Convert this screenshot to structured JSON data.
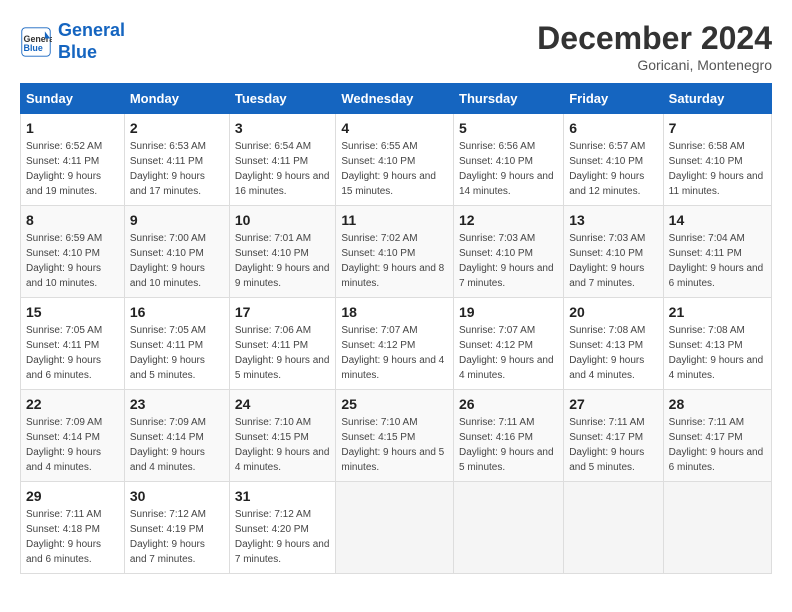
{
  "header": {
    "logo_line1": "General",
    "logo_line2": "Blue",
    "month": "December 2024",
    "location": "Goricani, Montenegro"
  },
  "columns": [
    "Sunday",
    "Monday",
    "Tuesday",
    "Wednesday",
    "Thursday",
    "Friday",
    "Saturday"
  ],
  "weeks": [
    [
      {
        "day": "1",
        "sunrise": "Sunrise: 6:52 AM",
        "sunset": "Sunset: 4:11 PM",
        "daylight": "Daylight: 9 hours and 19 minutes."
      },
      {
        "day": "2",
        "sunrise": "Sunrise: 6:53 AM",
        "sunset": "Sunset: 4:11 PM",
        "daylight": "Daylight: 9 hours and 17 minutes."
      },
      {
        "day": "3",
        "sunrise": "Sunrise: 6:54 AM",
        "sunset": "Sunset: 4:11 PM",
        "daylight": "Daylight: 9 hours and 16 minutes."
      },
      {
        "day": "4",
        "sunrise": "Sunrise: 6:55 AM",
        "sunset": "Sunset: 4:10 PM",
        "daylight": "Daylight: 9 hours and 15 minutes."
      },
      {
        "day": "5",
        "sunrise": "Sunrise: 6:56 AM",
        "sunset": "Sunset: 4:10 PM",
        "daylight": "Daylight: 9 hours and 14 minutes."
      },
      {
        "day": "6",
        "sunrise": "Sunrise: 6:57 AM",
        "sunset": "Sunset: 4:10 PM",
        "daylight": "Daylight: 9 hours and 12 minutes."
      },
      {
        "day": "7",
        "sunrise": "Sunrise: 6:58 AM",
        "sunset": "Sunset: 4:10 PM",
        "daylight": "Daylight: 9 hours and 11 minutes."
      }
    ],
    [
      {
        "day": "8",
        "sunrise": "Sunrise: 6:59 AM",
        "sunset": "Sunset: 4:10 PM",
        "daylight": "Daylight: 9 hours and 10 minutes."
      },
      {
        "day": "9",
        "sunrise": "Sunrise: 7:00 AM",
        "sunset": "Sunset: 4:10 PM",
        "daylight": "Daylight: 9 hours and 10 minutes."
      },
      {
        "day": "10",
        "sunrise": "Sunrise: 7:01 AM",
        "sunset": "Sunset: 4:10 PM",
        "daylight": "Daylight: 9 hours and 9 minutes."
      },
      {
        "day": "11",
        "sunrise": "Sunrise: 7:02 AM",
        "sunset": "Sunset: 4:10 PM",
        "daylight": "Daylight: 9 hours and 8 minutes."
      },
      {
        "day": "12",
        "sunrise": "Sunrise: 7:03 AM",
        "sunset": "Sunset: 4:10 PM",
        "daylight": "Daylight: 9 hours and 7 minutes."
      },
      {
        "day": "13",
        "sunrise": "Sunrise: 7:03 AM",
        "sunset": "Sunset: 4:10 PM",
        "daylight": "Daylight: 9 hours and 7 minutes."
      },
      {
        "day": "14",
        "sunrise": "Sunrise: 7:04 AM",
        "sunset": "Sunset: 4:11 PM",
        "daylight": "Daylight: 9 hours and 6 minutes."
      }
    ],
    [
      {
        "day": "15",
        "sunrise": "Sunrise: 7:05 AM",
        "sunset": "Sunset: 4:11 PM",
        "daylight": "Daylight: 9 hours and 6 minutes."
      },
      {
        "day": "16",
        "sunrise": "Sunrise: 7:05 AM",
        "sunset": "Sunset: 4:11 PM",
        "daylight": "Daylight: 9 hours and 5 minutes."
      },
      {
        "day": "17",
        "sunrise": "Sunrise: 7:06 AM",
        "sunset": "Sunset: 4:11 PM",
        "daylight": "Daylight: 9 hours and 5 minutes."
      },
      {
        "day": "18",
        "sunrise": "Sunrise: 7:07 AM",
        "sunset": "Sunset: 4:12 PM",
        "daylight": "Daylight: 9 hours and 4 minutes."
      },
      {
        "day": "19",
        "sunrise": "Sunrise: 7:07 AM",
        "sunset": "Sunset: 4:12 PM",
        "daylight": "Daylight: 9 hours and 4 minutes."
      },
      {
        "day": "20",
        "sunrise": "Sunrise: 7:08 AM",
        "sunset": "Sunset: 4:13 PM",
        "daylight": "Daylight: 9 hours and 4 minutes."
      },
      {
        "day": "21",
        "sunrise": "Sunrise: 7:08 AM",
        "sunset": "Sunset: 4:13 PM",
        "daylight": "Daylight: 9 hours and 4 minutes."
      }
    ],
    [
      {
        "day": "22",
        "sunrise": "Sunrise: 7:09 AM",
        "sunset": "Sunset: 4:14 PM",
        "daylight": "Daylight: 9 hours and 4 minutes."
      },
      {
        "day": "23",
        "sunrise": "Sunrise: 7:09 AM",
        "sunset": "Sunset: 4:14 PM",
        "daylight": "Daylight: 9 hours and 4 minutes."
      },
      {
        "day": "24",
        "sunrise": "Sunrise: 7:10 AM",
        "sunset": "Sunset: 4:15 PM",
        "daylight": "Daylight: 9 hours and 4 minutes."
      },
      {
        "day": "25",
        "sunrise": "Sunrise: 7:10 AM",
        "sunset": "Sunset: 4:15 PM",
        "daylight": "Daylight: 9 hours and 5 minutes."
      },
      {
        "day": "26",
        "sunrise": "Sunrise: 7:11 AM",
        "sunset": "Sunset: 4:16 PM",
        "daylight": "Daylight: 9 hours and 5 minutes."
      },
      {
        "day": "27",
        "sunrise": "Sunrise: 7:11 AM",
        "sunset": "Sunset: 4:17 PM",
        "daylight": "Daylight: 9 hours and 5 minutes."
      },
      {
        "day": "28",
        "sunrise": "Sunrise: 7:11 AM",
        "sunset": "Sunset: 4:17 PM",
        "daylight": "Daylight: 9 hours and 6 minutes."
      }
    ],
    [
      {
        "day": "29",
        "sunrise": "Sunrise: 7:11 AM",
        "sunset": "Sunset: 4:18 PM",
        "daylight": "Daylight: 9 hours and 6 minutes."
      },
      {
        "day": "30",
        "sunrise": "Sunrise: 7:12 AM",
        "sunset": "Sunset: 4:19 PM",
        "daylight": "Daylight: 9 hours and 7 minutes."
      },
      {
        "day": "31",
        "sunrise": "Sunrise: 7:12 AM",
        "sunset": "Sunset: 4:20 PM",
        "daylight": "Daylight: 9 hours and 7 minutes."
      },
      null,
      null,
      null,
      null
    ]
  ]
}
